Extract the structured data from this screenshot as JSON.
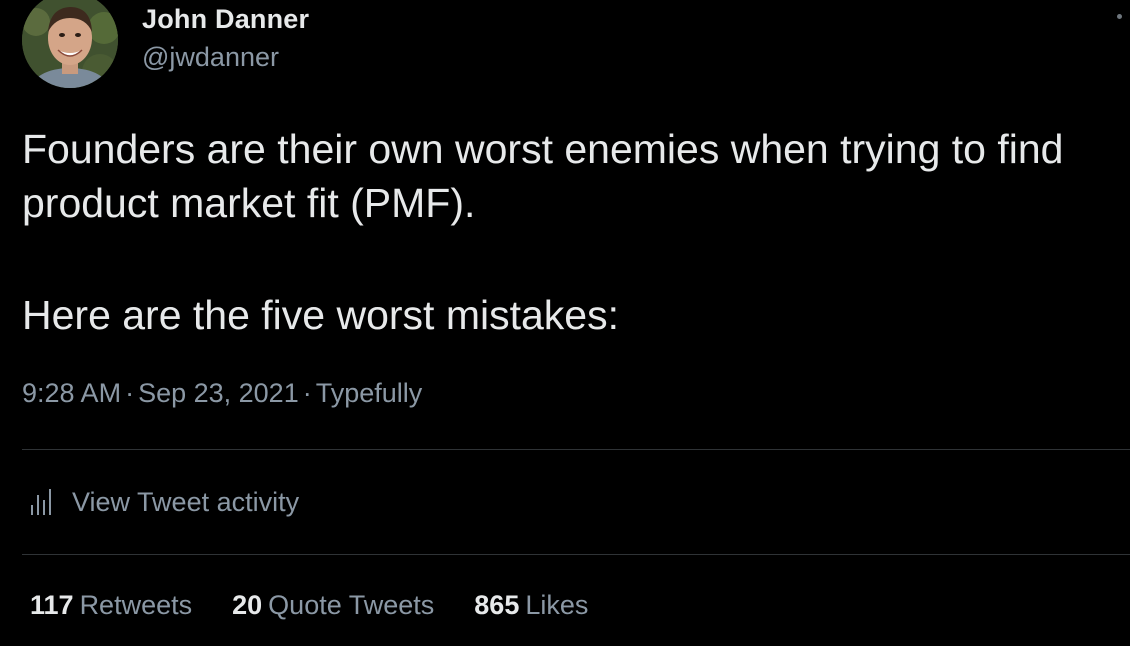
{
  "author": {
    "name": "John Danner",
    "handle": "@jwdanner"
  },
  "tweet": {
    "line1": "Founders are their own worst enemies when trying to find product market fit (PMF).",
    "line2": "Here are the five worst mistakes:"
  },
  "meta": {
    "time": "9:28 AM",
    "date": "Sep 23, 2021",
    "source": "Typefully",
    "separator": "·"
  },
  "activity": {
    "label": "View Tweet activity",
    "icon": "bar-chart-icon"
  },
  "stats": [
    {
      "count": "117",
      "label": "Retweets"
    },
    {
      "count": "20",
      "label": "Quote Tweets"
    },
    {
      "count": "865",
      "label": "Likes"
    }
  ],
  "colors": {
    "background": "#000000",
    "text_primary": "#e7e9ea",
    "text_secondary": "#8b98a5",
    "divider": "#2f3336"
  }
}
